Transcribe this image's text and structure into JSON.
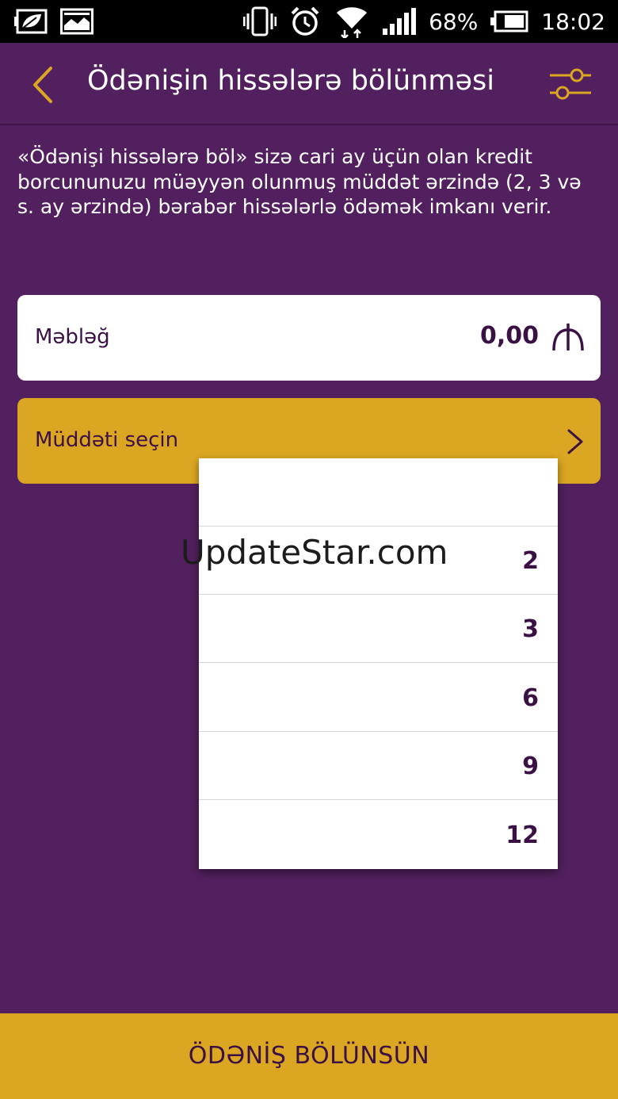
{
  "status_bar": {
    "battery_percent": "68%",
    "time": "18:02"
  },
  "header": {
    "title": "Ödənişin hissələrə bölünməsi",
    "back_icon": "chevron-left-icon",
    "settings_icon": "sliders-icon"
  },
  "description": "«Ödənişi hissələrə böl» sizə cari ay üçün olan kredit borcununuzu müəyyən olunmuş müddət ərzində (2, 3 və s. ay ərzində) bərabər hissələrlə ödəmək imkanı verir.",
  "amount": {
    "label": "Məbləğ",
    "value": "0,00",
    "currency_icon": "manat-icon"
  },
  "period": {
    "label": "Müddəti seçin",
    "icon": "chevron-right-icon"
  },
  "dropdown": {
    "options": [
      "",
      "2",
      "3",
      "6",
      "9",
      "12"
    ]
  },
  "watermark": "UpdateStar.com",
  "submit_button": "ÖDƏNİŞ BÖLÜNSÜN",
  "colors": {
    "background": "#52205e",
    "accent": "#dba622",
    "text_dark": "#3b1145"
  }
}
